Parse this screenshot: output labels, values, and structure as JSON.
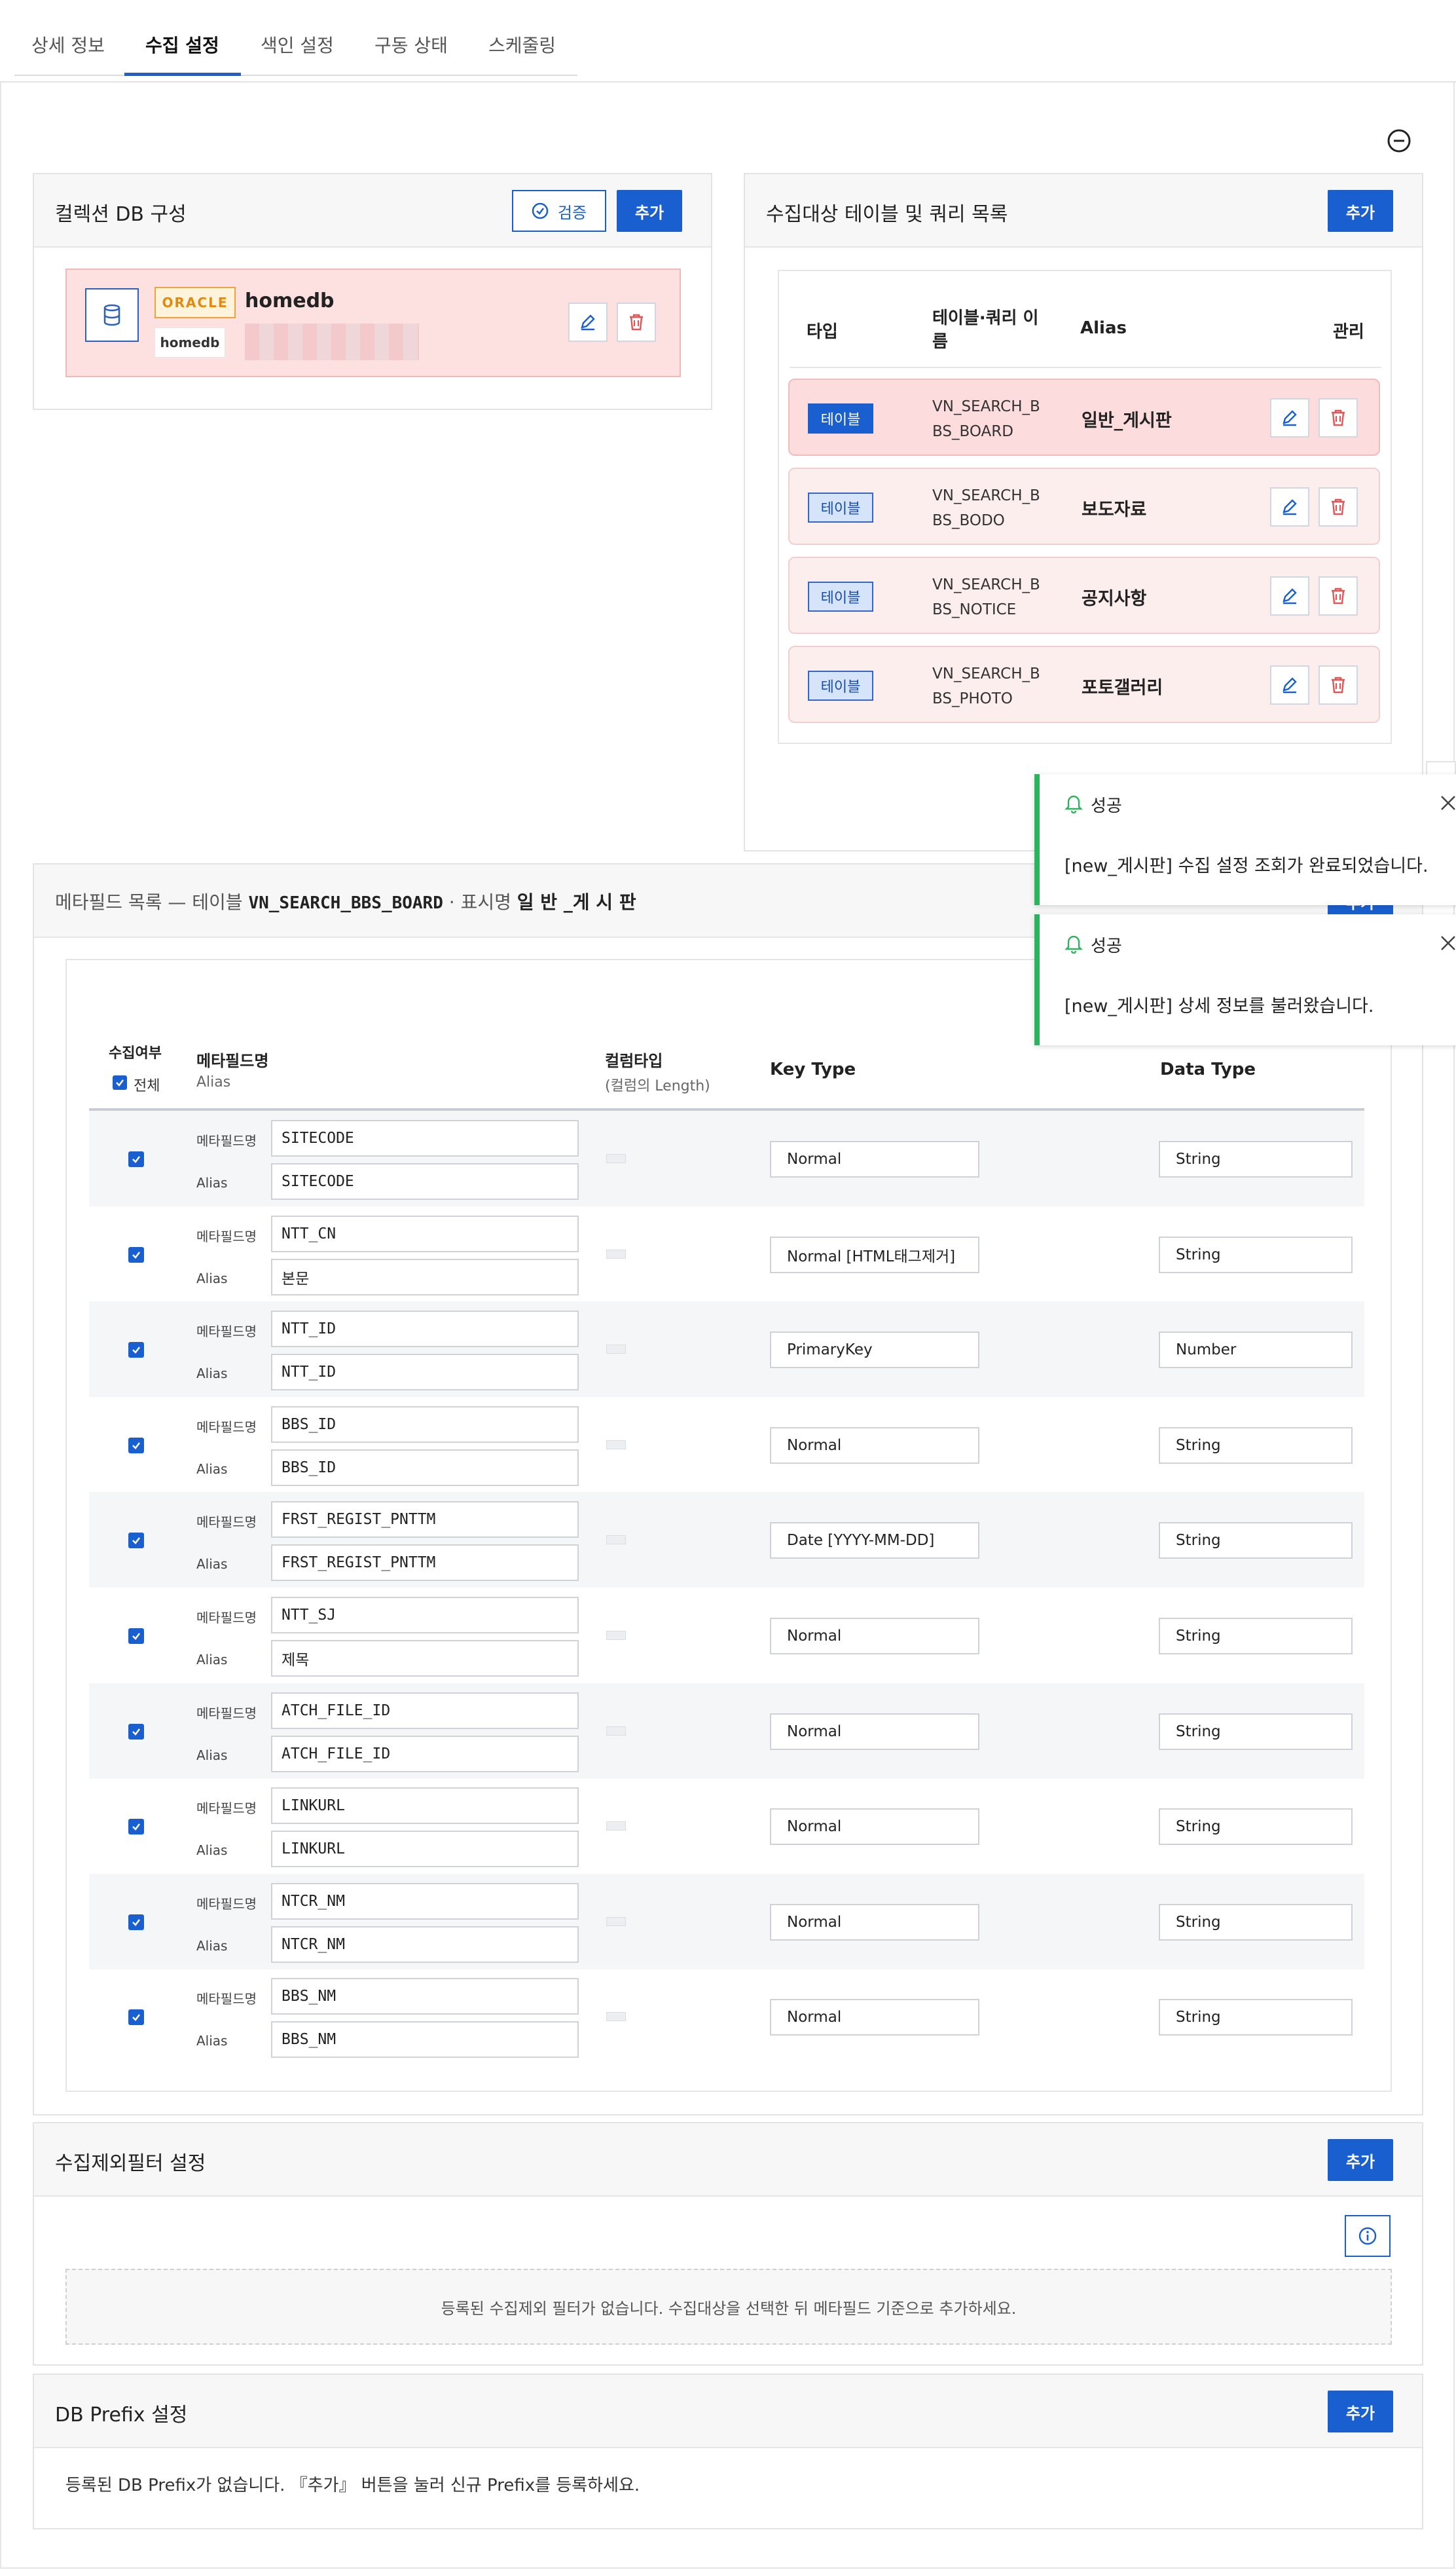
{
  "tabs": [
    {
      "label": "상세 정보",
      "active": false
    },
    {
      "label": "수집 설정",
      "active": true
    },
    {
      "label": "색인 설정",
      "active": false
    },
    {
      "label": "구동 상태",
      "active": false
    },
    {
      "label": "스케줄링",
      "active": false
    }
  ],
  "collect_db": {
    "title": "컬렉션 DB 구성",
    "verify_label": "검증",
    "add_label": "추가",
    "db": {
      "engine": "ORACLE",
      "name": "homedb",
      "tag": "homedb"
    }
  },
  "target_tables": {
    "title": "수집대상 테이블 및 쿼리 목록",
    "add_label": "추가",
    "headers": {
      "type": "타입",
      "name": "테이블·쿼리 이름",
      "alias": "Alias",
      "manage": "관리"
    },
    "rows": [
      {
        "type": "테이블",
        "name": "VN_SEARCH_BBS_BOARD",
        "alias": "일반_게시판",
        "selected": true
      },
      {
        "type": "테이블",
        "name": "VN_SEARCH_BBS_BODO",
        "alias": "보도자료",
        "selected": false
      },
      {
        "type": "테이블",
        "name": "VN_SEARCH_BBS_NOTICE",
        "alias": "공지사항",
        "selected": false
      },
      {
        "type": "테이블",
        "name": "VN_SEARCH_BBS_PHOTO",
        "alias": "포토갤러리",
        "selected": false
      }
    ]
  },
  "metafield": {
    "title_prefix": "메타필드 목록 — 테이블",
    "table": "VN_SEARCH_BBS_BOARD",
    "display_prefix": "· 표시명",
    "display_name": "일 반 _게 시 판",
    "add_label": "추가",
    "headers": {
      "collect": "수집여부",
      "all": "전체",
      "field": "메타필드명",
      "field_sub": "Alias",
      "col_type": "컬럼타입",
      "col_type_sub": "(컬럼의 Length)",
      "key_type": "Key Type",
      "data_type": "Data Type"
    },
    "field_label": "메타필드명",
    "alias_label": "Alias",
    "rows": [
      {
        "field": "SITECODE",
        "alias": "SITECODE",
        "key_type": "Normal",
        "data_type": "String"
      },
      {
        "field": "NTT_CN",
        "alias": "본문",
        "key_type": "Normal [HTML태그제거]",
        "data_type": "String"
      },
      {
        "field": "NTT_ID",
        "alias": "NTT_ID",
        "key_type": "PrimaryKey",
        "data_type": "Number"
      },
      {
        "field": "BBS_ID",
        "alias": "BBS_ID",
        "key_type": "Normal",
        "data_type": "String"
      },
      {
        "field": "FRST_REGIST_PNTTM",
        "alias": "FRST_REGIST_PNTTM",
        "key_type": "Date [YYYY-MM-DD]",
        "data_type": "String"
      },
      {
        "field": "NTT_SJ",
        "alias": "제목",
        "key_type": "Normal",
        "data_type": "String"
      },
      {
        "field": "ATCH_FILE_ID",
        "alias": "ATCH_FILE_ID",
        "key_type": "Normal",
        "data_type": "String"
      },
      {
        "field": "LINKURL",
        "alias": "LINKURL",
        "key_type": "Normal",
        "data_type": "String"
      },
      {
        "field": "NTCR_NM",
        "alias": "NTCR_NM",
        "key_type": "Normal",
        "data_type": "String"
      },
      {
        "field": "BBS_NM",
        "alias": "BBS_NM",
        "key_type": "Normal",
        "data_type": "String"
      }
    ]
  },
  "exclude_filter": {
    "title": "수집제외필터 설정",
    "add_label": "추가",
    "empty_text": "등록된 수집제외 필터가 없습니다. 수집대상을 선택한 뒤 메타필드 기준으로 추가하세요."
  },
  "db_prefix": {
    "title": "DB Prefix 설정",
    "add_label": "추가",
    "empty_text": "등록된 DB Prefix가 없습니다. 『추가』 버튼을 눌러 신규 Prefix를 등록하세요."
  },
  "toasts": [
    {
      "title": "성공",
      "message": "[new_게시판] 수집 설정 조회가 완료되었습니다."
    },
    {
      "title": "성공",
      "message": "[new_게시판] 상세 정보를 불러왔습니다."
    }
  ],
  "colors": {
    "primary": "#1a5fd0",
    "success": "#2db35d",
    "selected_row": "#fcdcdc",
    "danger": "#e35555"
  }
}
